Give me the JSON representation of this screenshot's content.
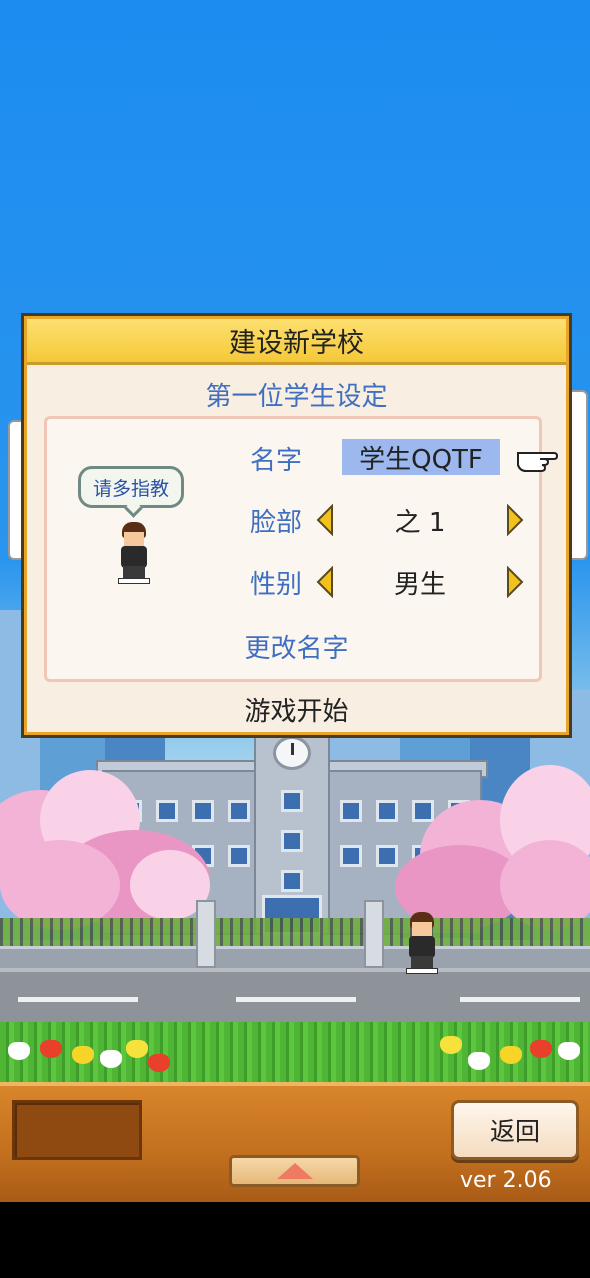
{
  "dialog": {
    "title": "建设新学校",
    "subtitle": "第一位学生设定",
    "speech_bubble": "请多指教",
    "fields": {
      "name_label": "名字",
      "name_value": "学生QQTF",
      "face_label": "脸部",
      "face_value": "之 1",
      "gender_label": "性别",
      "gender_value": "男生"
    },
    "change_name": "更改名字",
    "start_game": "游戏开始"
  },
  "bottom_bar": {
    "back_label": "返回",
    "version": "ver 2.06"
  },
  "colors": {
    "accent_blue": "#3f6fc0",
    "title_bar": "#f5c838",
    "name_highlight": "#9cb8ef",
    "arrow_yellow": "#f2c21c",
    "bottom_bar": "#c26f1e"
  },
  "icons": [
    "left-arrow-icon",
    "right-arrow-icon",
    "pointing-hand-icon",
    "up-triangle-icon"
  ]
}
